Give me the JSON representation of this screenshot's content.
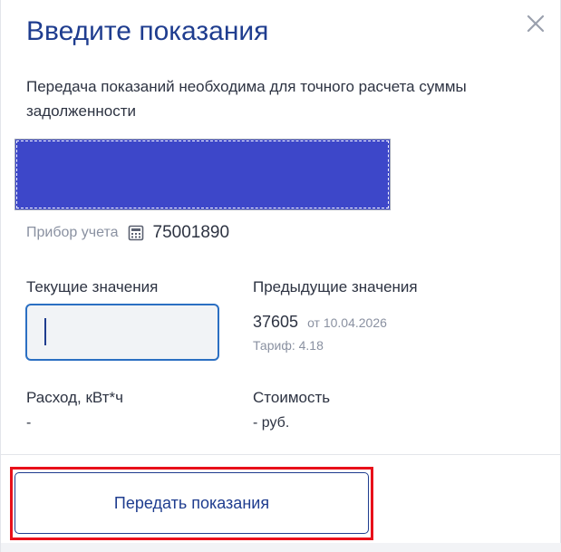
{
  "dialog": {
    "title": "Введите показания",
    "description": "Передача показаний необходима для точного расчета суммы задолженности"
  },
  "meter": {
    "label": "Прибор учета",
    "icon": "calculator-icon",
    "number": "75001890"
  },
  "current": {
    "label": "Текущие значения",
    "value": ""
  },
  "previous": {
    "label": "Предыдущие значения",
    "value": "37605",
    "date": "от 10.04.2026",
    "tariff": "Тариф: 4.18"
  },
  "consumption": {
    "label": "Расход, кВт*ч",
    "value": "-"
  },
  "cost": {
    "label": "Стоимость",
    "value": "- руб."
  },
  "actions": {
    "submit_label": "Передать показания"
  },
  "colors": {
    "accent": "#1f3d8f",
    "input_focus": "#2b6fc2",
    "highlight": "#e8101a",
    "redacted_block": "#3d47c9"
  }
}
